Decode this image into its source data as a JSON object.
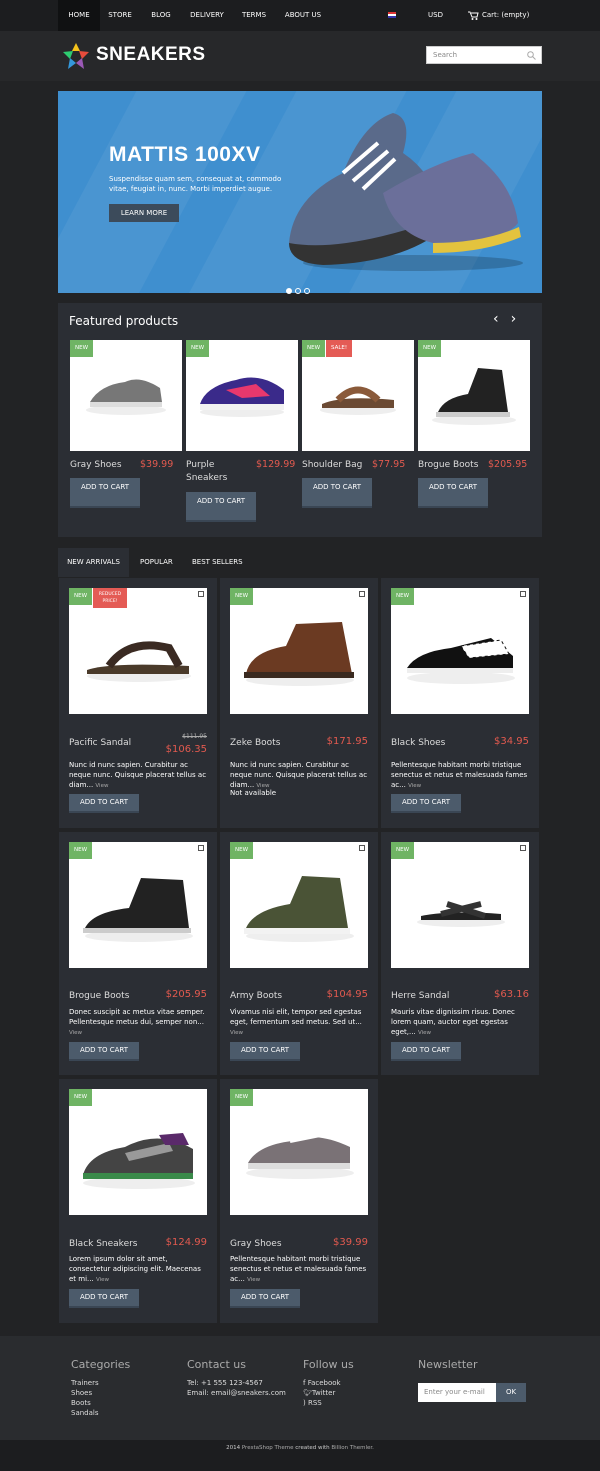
{
  "nav": {
    "items": [
      "HOME",
      "STORE",
      "BLOG",
      "DELIVERY",
      "TERMS",
      "ABOUT US"
    ],
    "currency": "USD",
    "cart": "Cart: (empty)"
  },
  "logo": {
    "text": "SNEAKERS"
  },
  "search": {
    "placeholder": "Search"
  },
  "hero": {
    "title": "MATTIS 100XV",
    "text": "Suspendisse quam sem, consequat at, commodo vitae, feugiat in, nunc. Morbi imperdiet augue.",
    "button": "LEARN MORE"
  },
  "featured": {
    "title": "Featured products",
    "products": [
      {
        "name": "Gray Shoes",
        "price": "$39.99",
        "badges": [
          "NEW"
        ],
        "button": "ADD TO CART"
      },
      {
        "name": "Purple Sneakers",
        "price": "$129.99",
        "badges": [
          "NEW"
        ],
        "button": "ADD TO CART"
      },
      {
        "name": "Shoulder Bag",
        "price": "$77.95",
        "badges": [
          "NEW",
          "SALE!"
        ],
        "button": "ADD TO CART"
      },
      {
        "name": "Brogue Boots",
        "price": "$205.95",
        "badges": [
          "NEW"
        ],
        "button": "ADD TO CART"
      }
    ]
  },
  "tabs": [
    "NEW ARRIVALS",
    "POPULAR",
    "BEST SELLERS"
  ],
  "products": [
    {
      "name": "Pacific Sandal",
      "price": "$106.35",
      "old": "$111.95",
      "badge": "NEW",
      "badge2": "REDUCED PRICE!",
      "desc": "Nunc id nunc sapien. Curabitur ac neque nunc. Quisque placerat tellus ac diam...",
      "view": "View",
      "button": "ADD TO CART"
    },
    {
      "name": "Zeke Boots",
      "price": "$171.95",
      "badge": "NEW",
      "desc": "Nunc id nunc sapien. Curabitur ac neque nunc. Quisque placerat tellus ac diam...",
      "view": "View",
      "avail": "Not available"
    },
    {
      "name": "Black Shoes",
      "price": "$34.95",
      "badge": "NEW",
      "desc": "Pellentesque habitant morbi tristique senectus et netus et malesuada fames ac...",
      "view": "View",
      "button": "ADD TO CART"
    },
    {
      "name": "Brogue Boots",
      "price": "$205.95",
      "badge": "NEW",
      "desc": "Donec suscipit ac metus vitae semper. Pellentesque metus dui, semper non...",
      "view": "View",
      "button": "ADD TO CART"
    },
    {
      "name": "Army Boots",
      "price": "$104.95",
      "badge": "NEW",
      "desc": "Vivamus nisi elit, tempor sed egestas eget, fermentum sed metus. Sed ut...",
      "view": "View",
      "button": "ADD TO CART"
    },
    {
      "name": "Herre Sandal",
      "price": "$63.16",
      "badge": "NEW",
      "desc": "Mauris vitae dignissim risus. Donec lorem quam, auctor eget egestas eget,...",
      "view": "View",
      "button": "ADD TO CART"
    },
    {
      "name": "Black Sneakers",
      "price": "$124.99",
      "badge": "NEW",
      "desc": "Lorem ipsum dolor sit amet, consectetur adipiscing elit. Maecenas et mi...",
      "view": "View",
      "button": "ADD TO CART"
    },
    {
      "name": "Gray Shoes",
      "price": "$39.99",
      "badge": "NEW",
      "desc": "Pellentesque habitant morbi tristique senectus et netus et malesuada fames ac...",
      "view": "View",
      "button": "ADD TO CART"
    }
  ],
  "footer": {
    "categories": {
      "title": "Categories",
      "items": [
        "Trainers",
        "Shoes",
        "Boots",
        "Sandals"
      ]
    },
    "contact": {
      "title": "Contact us",
      "tel_label": "Tel:",
      "tel": "+1 555 123-4567",
      "email_label": "Email:",
      "email": "email@sneakers.com"
    },
    "follow": {
      "title": "Follow us",
      "items": [
        "Facebook",
        "Twitter",
        "RSS"
      ]
    },
    "newsletter": {
      "title": "Newsletter",
      "placeholder": "Enter your e-mail",
      "button": "OK"
    }
  },
  "copyright": {
    "year": "2014",
    "theme": "PrestaShop Theme",
    "created": "created with",
    "author": "Billion Themler."
  },
  "colors": {
    "accent": "#e25a4f",
    "new_badge": "#6fb464",
    "hero": "#3f8fcf",
    "button": "#4c5b6b"
  }
}
